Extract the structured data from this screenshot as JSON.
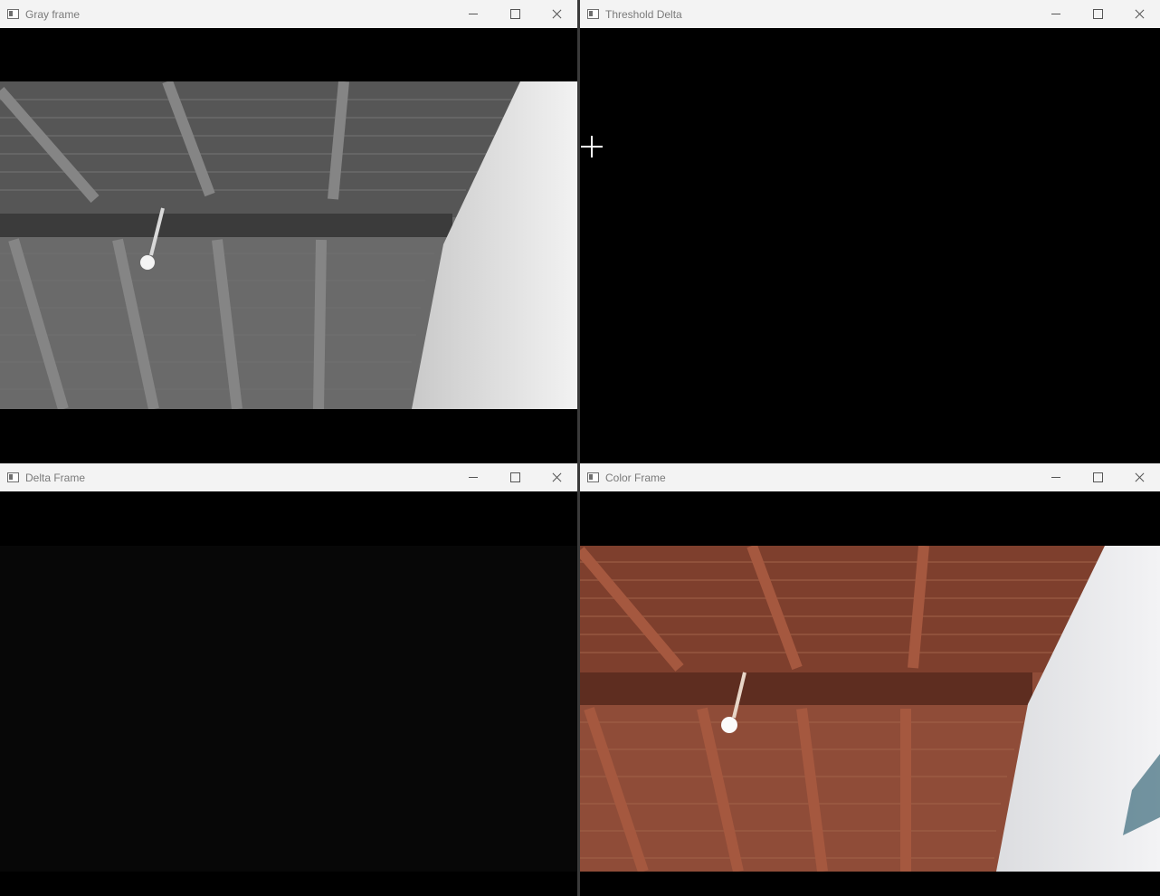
{
  "windows": {
    "gray": {
      "title": "Gray frame"
    },
    "threshold": {
      "title": "Threshold Delta"
    },
    "delta": {
      "title": "Delta Frame"
    },
    "color": {
      "title": "Color Frame"
    }
  },
  "icons": [
    "app-window-icon",
    "minimize-icon",
    "maximize-icon",
    "close-icon",
    "crosshair-cursor-icon"
  ],
  "colors": {
    "titlebar": "#f3f3f3",
    "title_text": "#7a7a7a",
    "wood": "#8a4a36",
    "wall": "#e6e6e8"
  }
}
